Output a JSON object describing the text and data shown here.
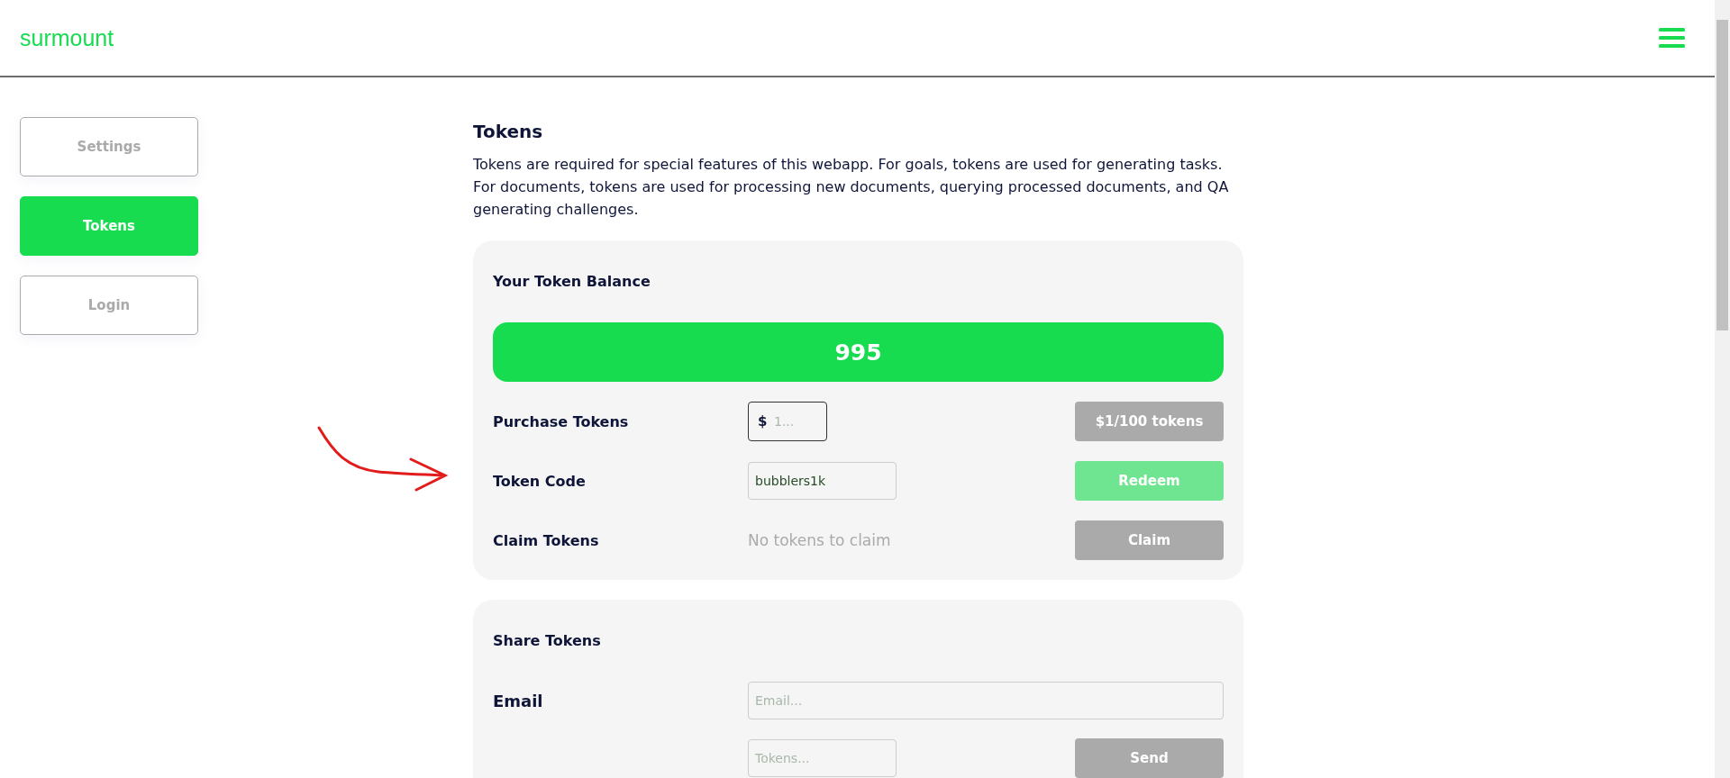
{
  "header": {
    "logo": "surmount"
  },
  "sidebar": {
    "items": [
      {
        "label": "Settings",
        "selected": false
      },
      {
        "label": "Tokens",
        "selected": true
      },
      {
        "label": "Login",
        "selected": false
      }
    ]
  },
  "main": {
    "title": "Tokens",
    "description": "Tokens are required for special features of this webapp. For goals, tokens are used for generating tasks. For documents, tokens are used for processing new documents, querying processed documents, and QA generating challenges.",
    "balance_card": {
      "title": "Your Token Balance",
      "balance": "995",
      "rows": [
        {
          "kind": "purchase",
          "label": "Purchase Tokens",
          "prefix": "$",
          "placeholder": "1...",
          "button": "$1/100 tokens",
          "disabled": true
        },
        {
          "kind": "code",
          "label": "Token Code",
          "value": "bubblers1k",
          "button": "Redeem",
          "disabled": false
        },
        {
          "kind": "claim",
          "label": "Claim Tokens",
          "note": "No tokens to claim",
          "button": "Claim",
          "disabled": true
        }
      ]
    },
    "share_card": {
      "title": "Share Tokens",
      "email_label": "Email",
      "email_placeholder": "Email...",
      "tokens_placeholder": "Tokens...",
      "button": "Send",
      "disabled": true
    }
  }
}
